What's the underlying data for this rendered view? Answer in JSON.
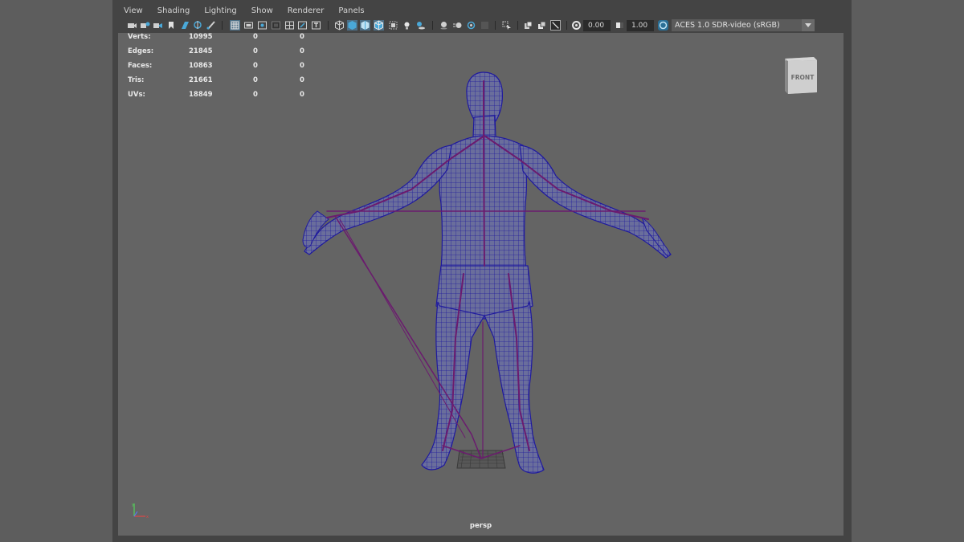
{
  "menubar": {
    "items": [
      "View",
      "Shading",
      "Lighting",
      "Show",
      "Renderer",
      "Panels"
    ]
  },
  "toolbar": {
    "icons": [
      "camera-select-icon",
      "camera-attributes-icon",
      "bookmark-icon",
      "image-plane-icon",
      "2d-pan-zoom-icon",
      "grease-pencil-icon",
      "grid-icon",
      "film-gate-icon",
      "resolution-gate-icon",
      "gate-mask-icon",
      "field-chart-icon",
      "safe-action-icon",
      "safe-title-icon",
      "wireframe-icon",
      "smooth-shade-icon",
      "default-material-icon",
      "wireframe-on-shaded-icon",
      "xray-icon",
      "use-all-lights-icon",
      "shadows-icon",
      "screen-space-ao-icon",
      "motion-blur-icon",
      "anti-aliasing-icon",
      "depth-of-field-icon",
      "isolate-select-icon",
      "xray-joints-icon",
      "xray-active-icon",
      "exposure-icon",
      "gamma-icon",
      "color-management-icon"
    ],
    "exposure_value": "0.00",
    "gamma_value": "1.00",
    "color_space": "ACES 1.0 SDR-video (sRGB)"
  },
  "hud": {
    "rows": [
      {
        "label": "Verts:",
        "c1": "10995",
        "c2": "0",
        "c3": "0"
      },
      {
        "label": "Edges:",
        "c1": "21845",
        "c2": "0",
        "c3": "0"
      },
      {
        "label": "Faces:",
        "c1": "10863",
        "c2": "0",
        "c3": "0"
      },
      {
        "label": "Tris:",
        "c1": "21661",
        "c2": "0",
        "c3": "0"
      },
      {
        "label": "UVs:",
        "c1": "18849",
        "c2": "0",
        "c3": "0"
      }
    ]
  },
  "viewcube": {
    "face_label": "FRONT"
  },
  "camera": {
    "name": "persp"
  },
  "colors": {
    "viewport_bg": "#646464",
    "mesh_wire": "#1f1a9e",
    "joint_line": "#6b1b6e",
    "active_icon": "#4aa8d8"
  }
}
